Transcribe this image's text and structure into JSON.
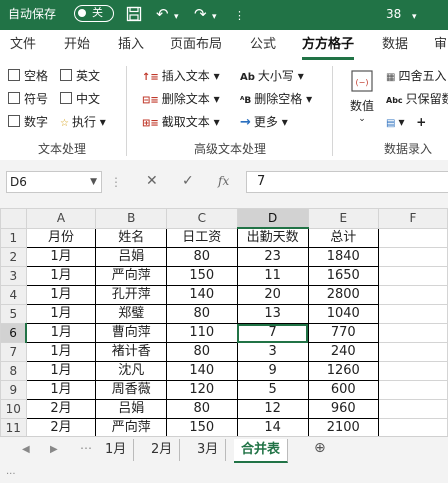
{
  "titlebar": {
    "autosave": "自动保存",
    "toggle": "关",
    "title": "38",
    "save_icon": "save-icon",
    "undo_icon": "undo-icon",
    "redo_icon": "redo-icon"
  },
  "tabs": [
    "文件",
    "开始",
    "插入",
    "页面布局",
    "公式",
    "方方格子",
    "数据",
    "审"
  ],
  "active_tab": "方方格子",
  "ribbon": {
    "group1": {
      "items": [
        "空格",
        "英文",
        "符号",
        "中文",
        "数字",
        "执行"
      ],
      "label": "文本处理"
    },
    "group2": {
      "items": [
        "插入文本",
        "删除文本",
        "截取文本",
        "大小写",
        "删除空格",
        "更多"
      ],
      "label": "高级文本处理"
    },
    "group3": {
      "numeric": "数值",
      "items": [
        "四舍五入",
        "只保留数"
      ],
      "ab_prefix": "Abc",
      "label": "数据录入"
    }
  },
  "formula_bar": {
    "name_box": "D6",
    "fx": "fx",
    "value": "7"
  },
  "columns": [
    "A",
    "B",
    "C",
    "D",
    "E",
    "F"
  ],
  "rows": [
    {
      "n": "1",
      "cells": [
        "月份",
        "姓名",
        "日工资",
        "出勤天数",
        "总计"
      ]
    },
    {
      "n": "2",
      "cells": [
        "1月",
        "吕娟",
        "80",
        "23",
        "1840"
      ]
    },
    {
      "n": "3",
      "cells": [
        "1月",
        "严向萍",
        "150",
        "11",
        "1650"
      ]
    },
    {
      "n": "4",
      "cells": [
        "1月",
        "孔开萍",
        "140",
        "20",
        "2800"
      ]
    },
    {
      "n": "5",
      "cells": [
        "1月",
        "郑璧",
        "80",
        "13",
        "1040"
      ]
    },
    {
      "n": "6",
      "cells": [
        "1月",
        "曹向萍",
        "110",
        "7",
        "770"
      ]
    },
    {
      "n": "7",
      "cells": [
        "1月",
        "褚计香",
        "80",
        "3",
        "240"
      ]
    },
    {
      "n": "8",
      "cells": [
        "1月",
        "沈凡",
        "140",
        "9",
        "1260"
      ]
    },
    {
      "n": "9",
      "cells": [
        "1月",
        "周香薇",
        "120",
        "5",
        "600"
      ]
    },
    {
      "n": "10",
      "cells": [
        "2月",
        "吕娟",
        "80",
        "12",
        "960"
      ]
    },
    {
      "n": "11",
      "cells": [
        "2月",
        "严向萍",
        "150",
        "14",
        "2100"
      ]
    }
  ],
  "sheets": [
    "1月",
    "2月",
    "3月",
    "合并表"
  ],
  "active_sheet": "合并表",
  "status": {
    "ellipsis": "..."
  }
}
